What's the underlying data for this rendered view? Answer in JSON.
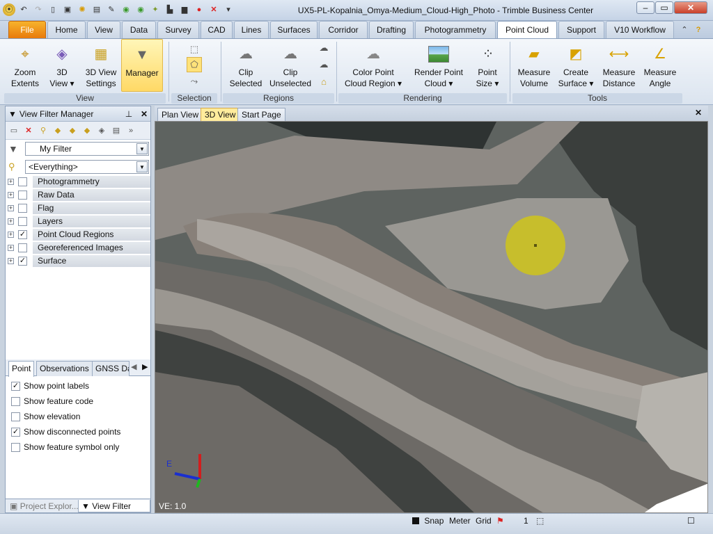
{
  "window": {
    "title": "UX5-PL-Kopalnia_Omya-Medium_Cloud-High_Photo - Trimble Business Center"
  },
  "ribbon_tabs": [
    "File",
    "Home",
    "View",
    "Data",
    "Survey",
    "CAD",
    "Lines",
    "Surfaces",
    "Corridor",
    "Drafting",
    "Photogrammetry",
    "Point Cloud",
    "Support",
    "V10 Workflow"
  ],
  "ribbon": {
    "view_group": {
      "label": "View",
      "buttons": [
        "Zoom\nExtents",
        "3D\nView ▾",
        "3D View\nSettings",
        "Manager"
      ]
    },
    "selection_group": {
      "label": "Selection"
    },
    "regions_group": {
      "label": "Regions",
      "buttons": [
        "Clip\nSelected",
        "Clip\nUnselected"
      ]
    },
    "rendering_group": {
      "label": "Rendering",
      "buttons": [
        "Color Point\nCloud Region ▾",
        "Render Point\nCloud ▾",
        "Point\nSize ▾"
      ]
    },
    "tools_group": {
      "label": "Tools",
      "buttons": [
        "Measure\nVolume",
        "Create\nSurface ▾",
        "Measure\nDistance",
        "Measure\nAngle"
      ]
    }
  },
  "panel": {
    "title": "View Filter Manager",
    "filter": "My Filter",
    "everything": "<Everything>",
    "tree": [
      {
        "label": "Photogrammetry",
        "checked": false
      },
      {
        "label": "Raw Data",
        "checked": false
      },
      {
        "label": "Flag",
        "checked": false
      },
      {
        "label": "Layers",
        "checked": false
      },
      {
        "label": "Point Cloud Regions",
        "checked": true
      },
      {
        "label": "Georeferenced Images",
        "checked": false
      },
      {
        "label": "Surface",
        "checked": true
      }
    ],
    "bottom_tabs": [
      "Point",
      "Observations",
      "GNSS Da"
    ],
    "options": [
      {
        "label": "Show point labels",
        "checked": true
      },
      {
        "label": "Show feature code",
        "checked": false
      },
      {
        "label": "Show elevation",
        "checked": false
      },
      {
        "label": "Show disconnected points",
        "checked": true
      },
      {
        "label": "Show feature symbol only",
        "checked": false
      }
    ],
    "pane_tabs": [
      "Project Explor...",
      "View Filter Ma..."
    ]
  },
  "view_tabs": [
    "Plan View",
    "3D View",
    "Start Page"
  ],
  "view": {
    "ve": "VE: 1.0",
    "axis_label": "E"
  },
  "status": {
    "snap": "Snap",
    "units": "Meter",
    "grid": "Grid",
    "count": "1"
  },
  "colors": {
    "accent": "#ffd966",
    "file_tab": "#e87a0c",
    "selection_disc": "#cfc41a"
  }
}
